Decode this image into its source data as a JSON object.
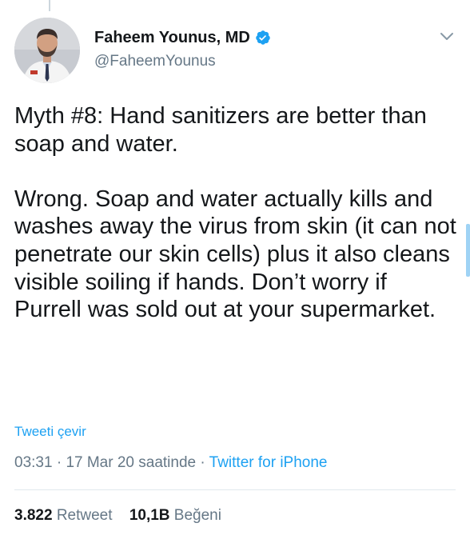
{
  "tweet": {
    "author": {
      "display_name": "Faheem Younus, MD",
      "handle": "@FaheemYounus",
      "verified_icon": "verified-badge-icon",
      "avatar_icon": "profile-photo"
    },
    "text": "Myth #8: Hand sanitizers are better than soap and water.\n\nWrong. Soap and water actually kills and washes away the virus from skin (it can not penetrate our skin cells) plus it also cleans visible soiling if hands. Don’t worry if Purrell was sold out at your supermarket.",
    "translate_label": "Tweeti çevir",
    "time": "03:31",
    "separator": " · ",
    "date": "17 Mar 20 saatinde",
    "source": "Twitter for iPhone",
    "stats": {
      "retweets_count": "3.822",
      "retweets_label": "Retweet",
      "likes_count": "10,1B",
      "likes_label": "Beğeni"
    }
  },
  "colors": {
    "accent": "#1da1f2",
    "text": "#14171a",
    "muted": "#657786",
    "divider": "#e1e8ed"
  },
  "icons": {
    "menu": "chevron-down-icon"
  }
}
